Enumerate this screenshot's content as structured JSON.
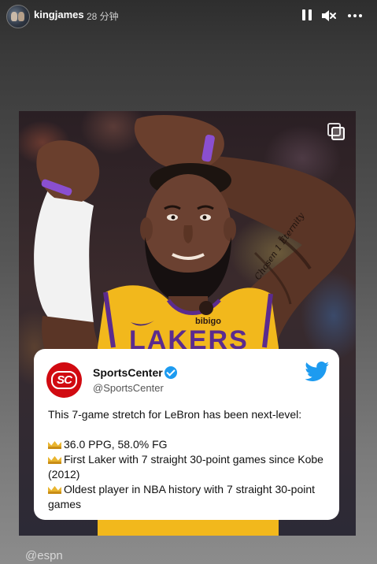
{
  "header": {
    "username": "kingjames",
    "time_ago": "28 分钟",
    "controls": {
      "pause_icon": "pause-icon",
      "mute_icon": "mute-icon",
      "more_icon": "more-icon"
    }
  },
  "post": {
    "jersey_sponsor": "bibigo",
    "jersey_text": "LAKERS",
    "tattoo_text": "Chosen 1 Eternity",
    "tweet": {
      "name": "SportsCenter",
      "handle": "@SportsCenter",
      "logo_text": "SC",
      "intro": "This 7-game stretch for LeBron has been next-level:",
      "bullets": [
        "36.0 PPG, 58.0% FG",
        "First Laker with 7 straight 30-point games since Kobe (2012)",
        "Oldest player in NBA history with 7 straight 30-point games"
      ]
    }
  },
  "credit": "@espn",
  "colors": {
    "accent_purple": "#8a4fd0",
    "laker_gold": "#f2b81c",
    "espn_red": "#d10a11",
    "twitter_blue": "#1d9bf0"
  }
}
